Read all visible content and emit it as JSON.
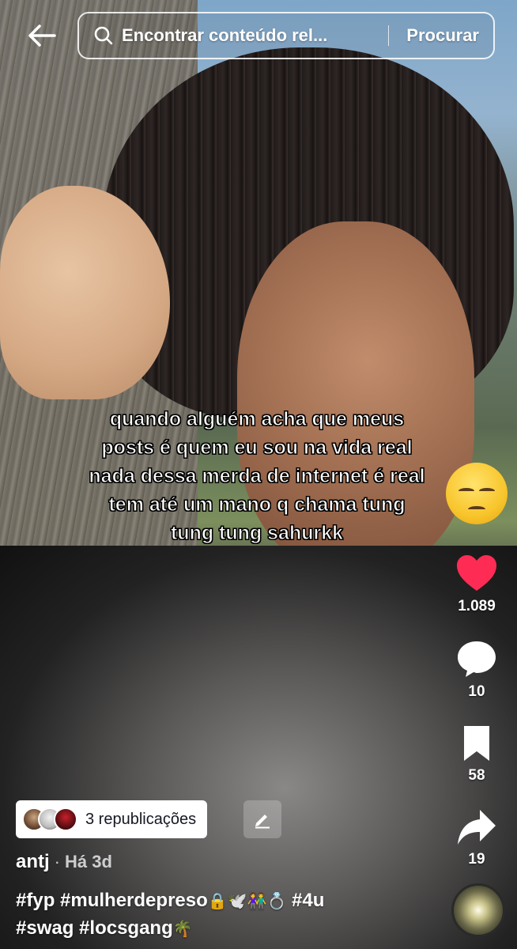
{
  "search": {
    "placeholder": "Encontrar conteúdo rel...",
    "button_label": "Procurar"
  },
  "caption": {
    "lines": [
      "quando alguém acha que meus",
      "posts é quem eu sou na vida real",
      "nada dessa merda de internet é real",
      "tem até um mano q chama tung",
      "tung tung sahurkk"
    ],
    "emoji": "pensive-face"
  },
  "rail": {
    "likes": "1.089",
    "comments": "10",
    "saves": "58",
    "shares": "19",
    "like_color": "#fe2c55"
  },
  "repost": {
    "label": "3 republicações"
  },
  "post": {
    "author": "antj",
    "separator": "·",
    "time": "Há 3d",
    "hashtags_line1": [
      "#fyp",
      "#mulherdepreso"
    ],
    "emojis_line1": "🔒🕊️👫💍",
    "hashtag_4u": "#4u",
    "hashtags_line2": [
      "#swag",
      "#locsgang"
    ],
    "emoji_line2": "🌴"
  }
}
